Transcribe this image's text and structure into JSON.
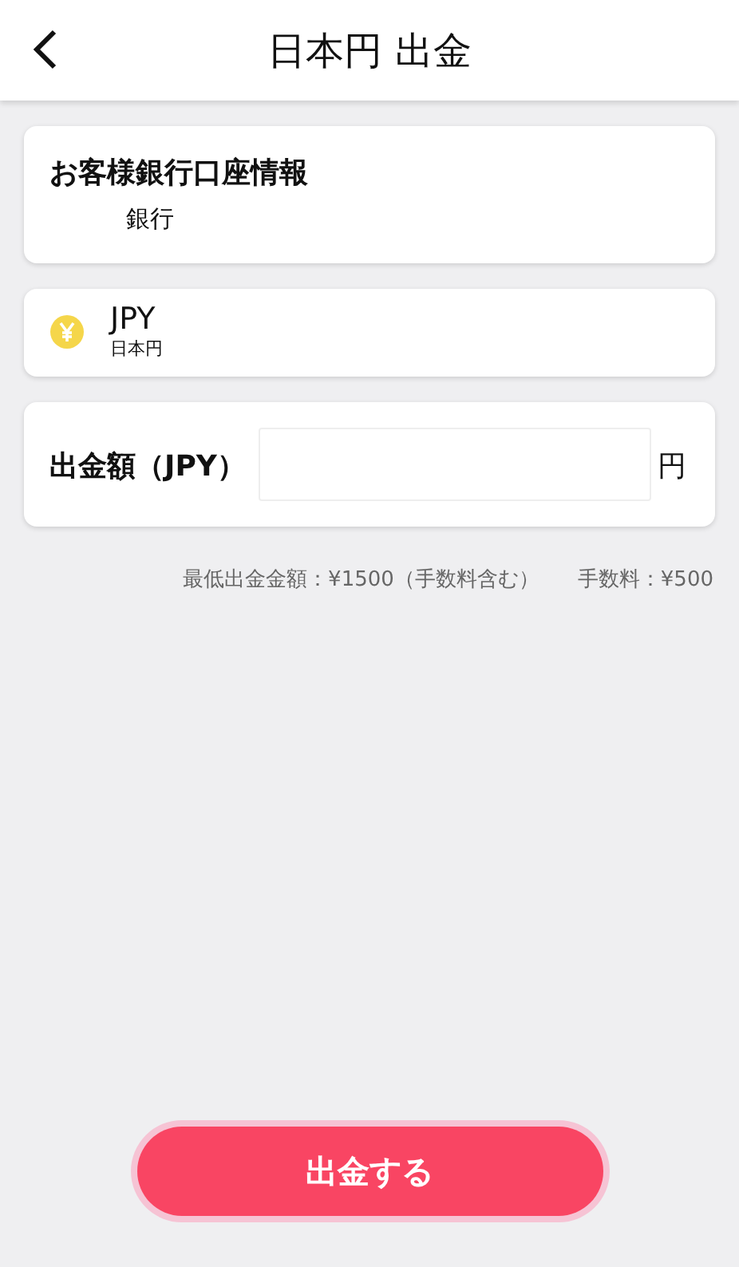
{
  "header": {
    "title": "日本円 出金"
  },
  "bank_card": {
    "title": "お客様銀行口座情報",
    "bank": "銀行"
  },
  "currency_card": {
    "code": "JPY",
    "name": "日本円"
  },
  "amount_card": {
    "label": "出金額（JPY）",
    "unit": "円"
  },
  "notes": [
    "最低出金金額：¥1500（手数料含む）",
    "手数料：¥500"
  ],
  "submit_button": {
    "label": "出金する",
    "focused": true
  }
}
